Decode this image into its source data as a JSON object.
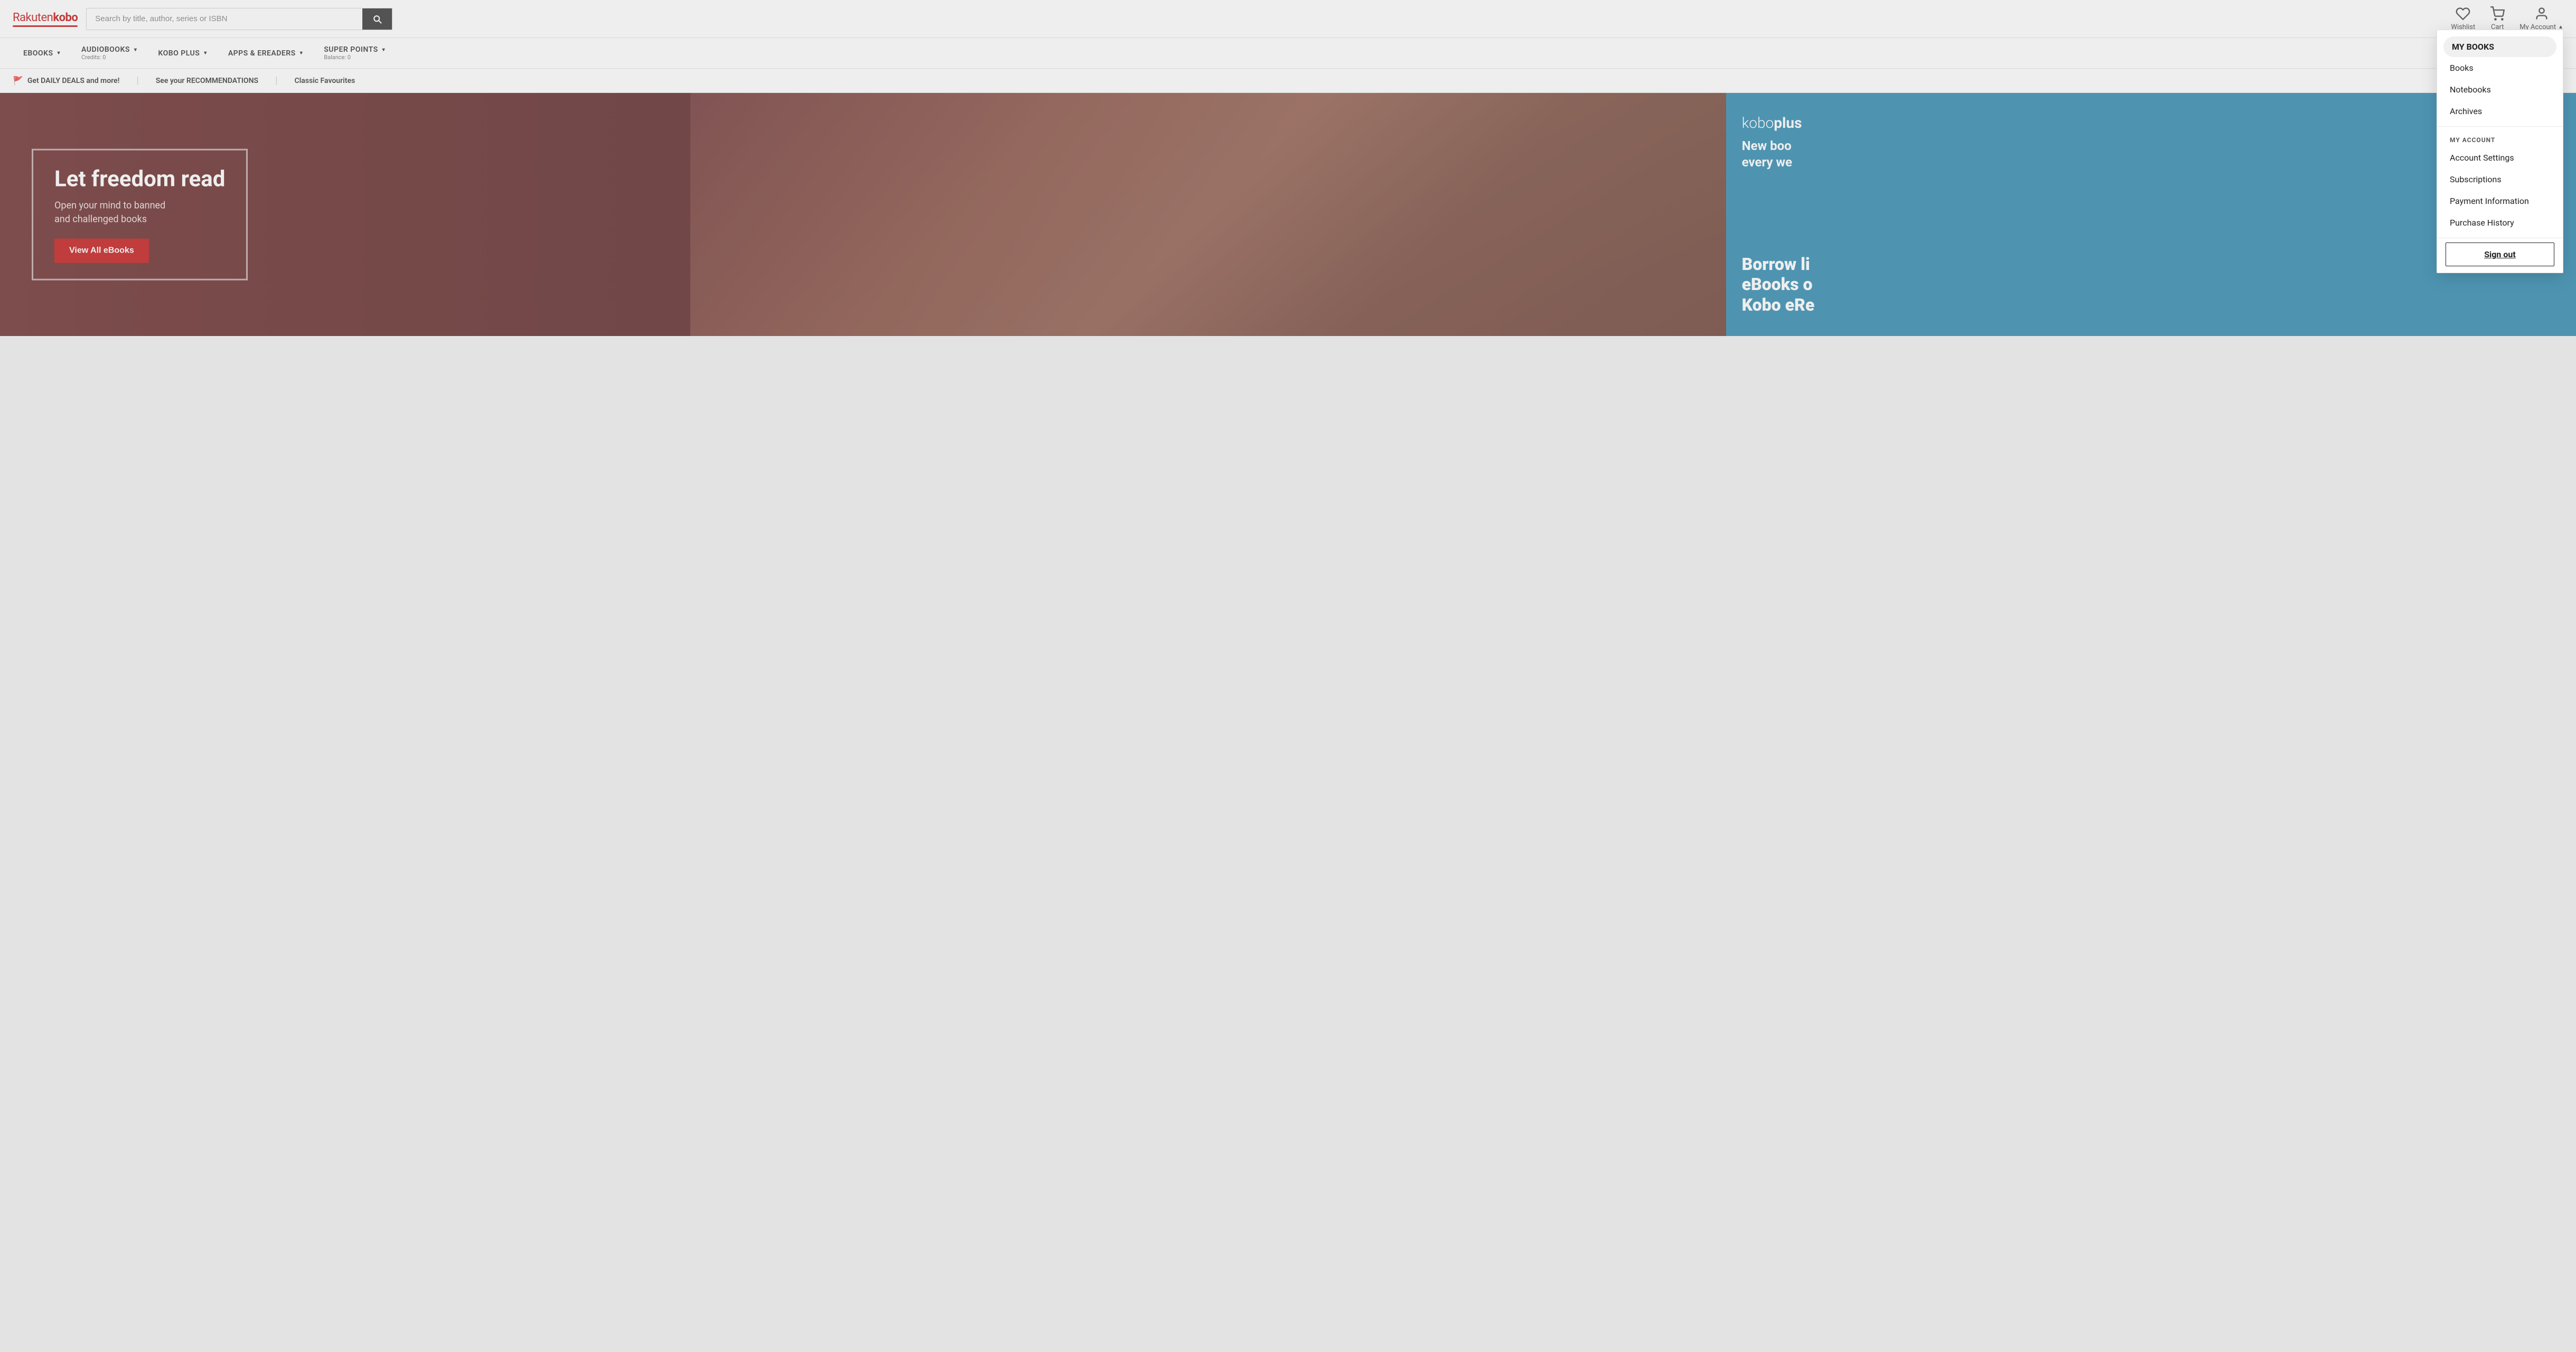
{
  "logo": {
    "rakuten": "Rakuten",
    "kobo": "kobo"
  },
  "search": {
    "placeholder": "Search by title, author, series or ISBN"
  },
  "header": {
    "wishlist_label": "Wishlist",
    "cart_label": "Cart",
    "my_account_label": "My Account"
  },
  "nav": {
    "items": [
      {
        "label": "eBOOKS",
        "has_arrow": true,
        "sub": ""
      },
      {
        "label": "AUDIOBOOKS",
        "has_arrow": true,
        "sub": "Credits: 0"
      },
      {
        "label": "KOBO PLUS",
        "has_arrow": true,
        "sub": ""
      },
      {
        "label": "APPS & eREADERS",
        "has_arrow": true,
        "sub": ""
      },
      {
        "label": "SUPER POINTS",
        "has_arrow": true,
        "sub": "Balance: 0"
      }
    ]
  },
  "promo_bar": {
    "items": [
      {
        "icon": "flag",
        "text": "Get DAILY DEALS and more!"
      },
      {
        "text": "See your RECOMMENDATIONS"
      },
      {
        "text": "Classic Favourites"
      }
    ]
  },
  "hero": {
    "title": "Let freedom read",
    "subtitle": "Open your mind to banned\nand challenged books",
    "button_label": "View All eBooks"
  },
  "kobo_plus": {
    "logo_prefix": "kobo",
    "logo_suffix": "plus",
    "tagline": "New boo\nevery we",
    "borrow_line1": "Borrow li",
    "borrow_line2": "eBooks o",
    "borrow_line3": "Kobo eRe"
  },
  "dropdown": {
    "my_books_section": "MY BOOKS",
    "my_books_active": "MY BOOKS",
    "books_item": "Books",
    "notebooks_item": "Notebooks",
    "archives_item": "Archives",
    "my_account_section": "MY ACCOUNT",
    "account_settings_item": "Account Settings",
    "subscriptions_item": "Subscriptions",
    "payment_information_item": "Payment Information",
    "purchase_history_item": "Purchase History",
    "sign_out_label": "Sign out"
  }
}
